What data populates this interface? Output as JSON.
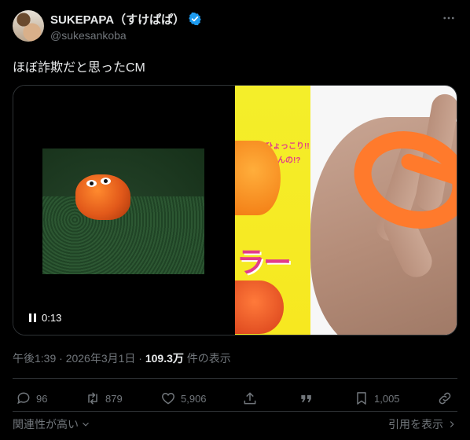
{
  "author": {
    "display_name": "SUKEPAPA（すけぱぱ）",
    "handle": "@sukesankoba",
    "verified": true
  },
  "tweet": {
    "text": "ほぼ詐欺だと思ったCM"
  },
  "media": {
    "video_time": "0:13",
    "package_line1": "トコにひょっこり!!",
    "package_line2": "いきてんの!?",
    "package_big": "ラー"
  },
  "meta": {
    "timestamp": "午後1:39 · 2026年3月1日 · ",
    "views": "109.3万",
    "views_suffix": " 件の表示"
  },
  "actions": {
    "replies": "96",
    "reposts": "879",
    "likes": "5,906",
    "bookmarks": "1,005"
  },
  "footer": {
    "sort_label": "関連性が高い",
    "quotes_label": "引用を表示"
  },
  "colors": {
    "background": "#000000",
    "text": "#e7e9ea",
    "muted": "#71767b",
    "verified": "#1d9bf0"
  }
}
